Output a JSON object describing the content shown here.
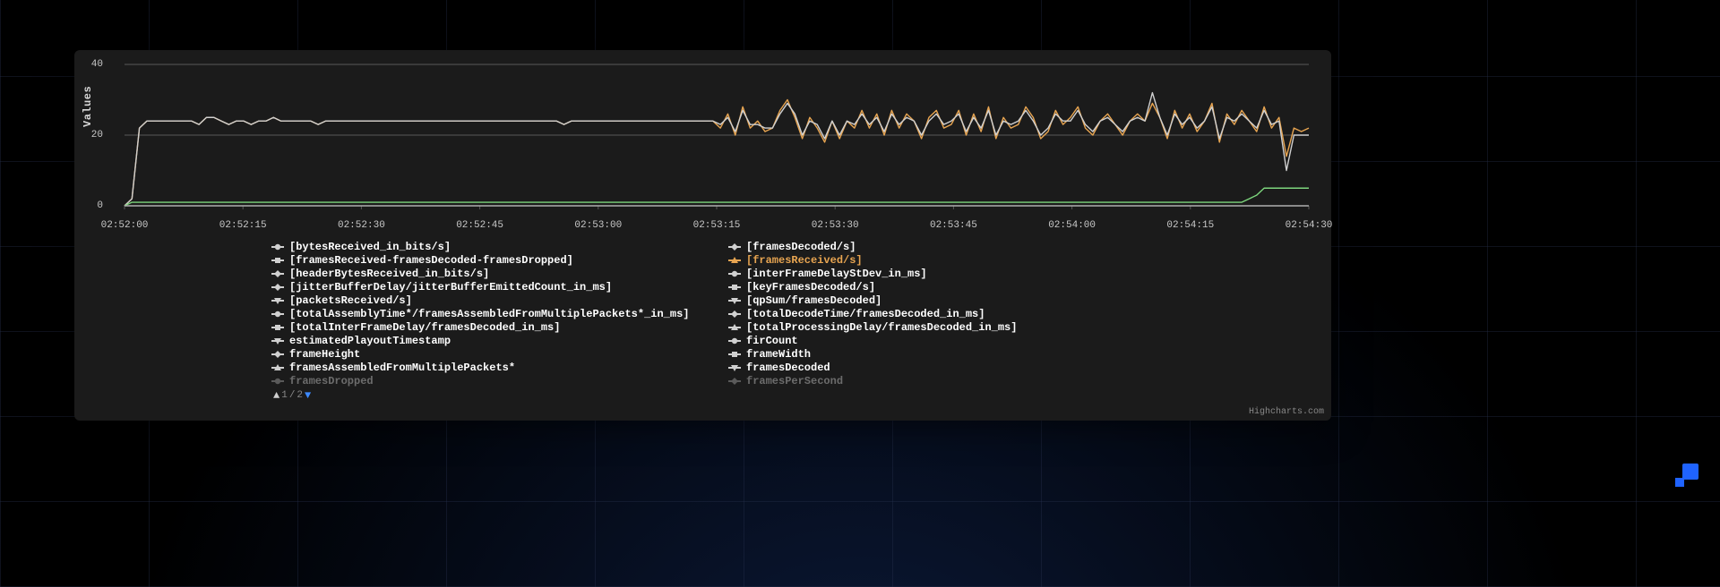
{
  "chart_data": {
    "type": "line",
    "ylabel": "Values",
    "ylim": [
      0,
      40
    ],
    "y_ticks": [
      0,
      20,
      40
    ],
    "x_labels": [
      "02:52:00",
      "02:52:15",
      "02:52:30",
      "02:52:45",
      "02:53:00",
      "02:53:15",
      "02:53:30",
      "02:53:45",
      "02:54:00",
      "02:54:15",
      "02:54:30"
    ],
    "x": [
      0,
      1,
      2,
      3,
      4,
      5,
      6,
      7,
      8,
      9,
      10,
      11,
      12,
      13,
      14,
      15,
      16,
      17,
      18,
      19,
      20,
      21,
      22,
      23,
      24,
      25,
      26,
      27,
      28,
      29,
      30,
      31,
      32,
      33,
      34,
      35,
      36,
      37,
      38,
      39,
      40,
      41,
      42,
      43,
      44,
      45,
      46,
      47,
      48,
      49,
      50,
      51,
      52,
      53,
      54,
      55,
      56,
      57,
      58,
      59,
      60,
      61,
      62,
      63,
      64,
      65,
      66,
      67,
      68,
      69,
      70,
      71,
      72,
      73,
      74,
      75,
      76,
      77,
      78,
      79,
      80,
      81,
      82,
      83,
      84,
      85,
      86,
      87,
      88,
      89,
      90,
      91,
      92,
      93,
      94,
      95,
      96,
      97,
      98,
      99,
      100,
      101,
      102,
      103,
      104,
      105,
      106,
      107,
      108,
      109,
      110,
      111,
      112,
      113,
      114,
      115,
      116,
      117,
      118,
      119,
      120,
      121,
      122,
      123,
      124,
      125,
      126,
      127,
      128,
      129,
      130,
      131,
      132,
      133,
      134,
      135,
      136,
      137,
      138,
      139,
      140,
      141,
      142,
      143,
      144,
      145,
      146,
      147,
      148,
      149,
      150,
      151,
      152,
      153,
      154,
      155,
      156,
      157,
      158,
      159
    ],
    "series": [
      {
        "name": "[framesReceived/s]",
        "color": "#e8a551",
        "values": [
          0,
          2,
          22,
          24,
          24,
          24,
          24,
          24,
          24,
          24,
          23,
          25,
          25,
          24,
          23,
          24,
          24,
          23,
          24,
          24,
          25,
          24,
          24,
          24,
          24,
          24,
          23,
          24,
          24,
          24,
          24,
          24,
          24,
          24,
          24,
          24,
          24,
          24,
          24,
          24,
          24,
          24,
          24,
          24,
          24,
          24,
          24,
          24,
          24,
          24,
          24,
          24,
          24,
          24,
          24,
          24,
          24,
          24,
          24,
          23,
          24,
          24,
          24,
          24,
          24,
          24,
          24,
          24,
          24,
          24,
          24,
          24,
          24,
          24,
          24,
          24,
          24,
          24,
          24,
          24,
          22,
          26,
          20,
          28,
          22,
          24,
          21,
          22,
          27,
          30,
          25,
          19,
          25,
          22,
          18,
          24,
          19,
          24,
          22,
          27,
          22,
          26,
          20,
          27,
          22,
          26,
          24,
          19,
          25,
          27,
          22,
          23,
          27,
          20,
          26,
          21,
          28,
          19,
          25,
          22,
          23,
          28,
          25,
          19,
          21,
          27,
          23,
          25,
          28,
          22,
          20,
          24,
          26,
          23,
          20,
          24,
          26,
          24,
          29,
          25,
          19,
          27,
          22,
          26,
          21,
          24,
          29,
          18,
          26,
          23,
          27,
          24,
          21,
          28,
          22,
          25,
          14,
          22,
          21,
          22
        ]
      },
      {
        "name": "[framesDecoded/s]",
        "color": "#d0d0d0",
        "values": [
          0,
          2,
          22,
          24,
          24,
          24,
          24,
          24,
          24,
          24,
          23,
          25,
          25,
          24,
          23,
          24,
          24,
          23,
          24,
          24,
          25,
          24,
          24,
          24,
          24,
          24,
          23,
          24,
          24,
          24,
          24,
          24,
          24,
          24,
          24,
          24,
          24,
          24,
          24,
          24,
          24,
          24,
          24,
          24,
          24,
          24,
          24,
          24,
          24,
          24,
          24,
          24,
          24,
          24,
          24,
          24,
          24,
          24,
          24,
          23,
          24,
          24,
          24,
          24,
          24,
          24,
          24,
          24,
          24,
          24,
          24,
          24,
          24,
          24,
          24,
          24,
          24,
          24,
          24,
          24,
          23,
          25,
          21,
          27,
          23,
          23,
          22,
          22,
          26,
          29,
          26,
          20,
          24,
          23,
          19,
          24,
          20,
          24,
          23,
          26,
          23,
          25,
          21,
          26,
          23,
          25,
          24,
          20,
          24,
          26,
          23,
          24,
          26,
          21,
          25,
          22,
          27,
          20,
          24,
          23,
          24,
          27,
          24,
          20,
          22,
          26,
          24,
          24,
          27,
          23,
          21,
          24,
          25,
          23,
          21,
          24,
          25,
          24,
          32,
          25,
          20,
          26,
          23,
          25,
          22,
          24,
          28,
          19,
          25,
          24,
          26,
          24,
          22,
          27,
          23,
          24,
          10,
          20,
          20,
          20
        ]
      },
      {
        "name": "[keyFramesDecoded/s]",
        "color": "#7dd67d",
        "values": [
          0,
          1,
          1,
          1,
          1,
          1,
          1,
          1,
          1,
          1,
          1,
          1,
          1,
          1,
          1,
          1,
          1,
          1,
          1,
          1,
          1,
          1,
          1,
          1,
          1,
          1,
          1,
          1,
          1,
          1,
          1,
          1,
          1,
          1,
          1,
          1,
          1,
          1,
          1,
          1,
          1,
          1,
          1,
          1,
          1,
          1,
          1,
          1,
          1,
          1,
          1,
          1,
          1,
          1,
          1,
          1,
          1,
          1,
          1,
          1,
          1,
          1,
          1,
          1,
          1,
          1,
          1,
          1,
          1,
          1,
          1,
          1,
          1,
          1,
          1,
          1,
          1,
          1,
          1,
          1,
          1,
          1,
          1,
          1,
          1,
          1,
          1,
          1,
          1,
          1,
          1,
          1,
          1,
          1,
          1,
          1,
          1,
          1,
          1,
          1,
          1,
          1,
          1,
          1,
          1,
          1,
          1,
          1,
          1,
          1,
          1,
          1,
          1,
          1,
          1,
          1,
          1,
          1,
          1,
          1,
          1,
          1,
          1,
          1,
          1,
          1,
          1,
          1,
          1,
          1,
          1,
          1,
          1,
          1,
          1,
          1,
          1,
          1,
          1,
          1,
          1,
          1,
          1,
          1,
          1,
          1,
          1,
          1,
          1,
          1,
          1,
          2,
          3,
          5,
          5,
          5,
          5,
          5,
          5,
          5
        ]
      },
      {
        "name": "[framesReceived-framesDecoded-framesDropped]",
        "color": "#b0b0b0",
        "values": [
          0,
          0,
          0,
          0,
          0,
          0,
          0,
          0,
          0,
          0,
          0,
          0,
          0,
          0,
          0,
          0,
          0,
          0,
          0,
          0,
          0,
          0,
          0,
          0,
          0,
          0,
          0,
          0,
          0,
          0,
          0,
          0,
          0,
          0,
          0,
          0,
          0,
          0,
          0,
          0,
          0,
          0,
          0,
          0,
          0,
          0,
          0,
          0,
          0,
          0,
          0,
          0,
          0,
          0,
          0,
          0,
          0,
          0,
          0,
          0,
          0,
          0,
          0,
          0,
          0,
          0,
          0,
          0,
          0,
          0,
          0,
          0,
          0,
          0,
          0,
          0,
          0,
          0,
          0,
          0,
          0,
          0,
          0,
          0,
          0,
          0,
          0,
          0,
          0,
          0,
          0,
          0,
          0,
          0,
          0,
          0,
          0,
          0,
          0,
          0,
          0,
          0,
          0,
          0,
          0,
          0,
          0,
          0,
          0,
          0,
          0,
          0,
          0,
          0,
          0,
          0,
          0,
          0,
          0,
          0,
          0,
          0,
          0,
          0,
          0,
          0,
          0,
          0,
          0,
          0,
          0,
          0,
          0,
          0,
          0,
          0,
          0,
          0,
          0,
          0,
          0,
          0,
          0,
          0,
          0,
          0,
          0,
          0,
          0,
          0,
          0,
          0,
          0,
          0,
          0,
          0,
          0,
          0,
          0,
          0
        ]
      }
    ]
  },
  "legend_rows": 11,
  "legend_items": [
    {
      "label": "[bytesReceived_in_bits/s]",
      "marker": "circle",
      "color": "#d0d0d0"
    },
    {
      "label": "[framesReceived-framesDecoded-framesDropped]",
      "marker": "square",
      "color": "#d0d0d0"
    },
    {
      "label": "[headerBytesReceived_in_bits/s]",
      "marker": "diamond",
      "color": "#d0d0d0"
    },
    {
      "label": "[jitterBufferDelay/jitterBufferEmittedCount_in_ms]",
      "marker": "diamond",
      "color": "#d0d0d0"
    },
    {
      "label": "[packetsReceived/s]",
      "marker": "tri-down",
      "color": "#d0d0d0"
    },
    {
      "label": "[totalAssemblyTime*/framesAssembledFromMultiplePackets*_in_ms]",
      "marker": "circle",
      "color": "#d0d0d0"
    },
    {
      "label": "[totalInterFrameDelay/framesDecoded_in_ms]",
      "marker": "square",
      "color": "#d0d0d0"
    },
    {
      "label": "estimatedPlayoutTimestamp",
      "marker": "tri-down",
      "color": "#d0d0d0"
    },
    {
      "label": "frameHeight",
      "marker": "diamond",
      "color": "#d0d0d0"
    },
    {
      "label": "framesAssembledFromMultiplePackets*",
      "marker": "tri-up",
      "color": "#d0d0d0"
    },
    {
      "label": "framesDropped",
      "marker": "circle",
      "color": "#d0d0d0",
      "faded": true
    },
    {
      "label": "[framesDecoded/s]",
      "marker": "diamond",
      "color": "#d0d0d0"
    },
    {
      "label": "[framesReceived/s]",
      "marker": "tri-up",
      "color": "#e8a551",
      "highlight": true
    },
    {
      "label": "[interFrameDelayStDev_in_ms]",
      "marker": "circle",
      "color": "#d0d0d0"
    },
    {
      "label": "[keyFramesDecoded/s]",
      "marker": "square",
      "color": "#d0d0d0"
    },
    {
      "label": "[qpSum/framesDecoded]",
      "marker": "tri-down",
      "color": "#d0d0d0"
    },
    {
      "label": "[totalDecodeTime/framesDecoded_in_ms]",
      "marker": "diamond",
      "color": "#d0d0d0"
    },
    {
      "label": "[totalProcessingDelay/framesDecoded_in_ms]",
      "marker": "tri-up",
      "color": "#d0d0d0"
    },
    {
      "label": "firCount",
      "marker": "circle",
      "color": "#d0d0d0"
    },
    {
      "label": "frameWidth",
      "marker": "square",
      "color": "#d0d0d0"
    },
    {
      "label": "framesDecoded",
      "marker": "tri-down",
      "color": "#d0d0d0"
    },
    {
      "label": "framesPerSecond",
      "marker": "diamond",
      "color": "#d0d0d0",
      "faded": true
    }
  ],
  "pager": {
    "page": "1",
    "total": "2"
  },
  "credit": "Highcharts.com",
  "ylabel": "Values"
}
